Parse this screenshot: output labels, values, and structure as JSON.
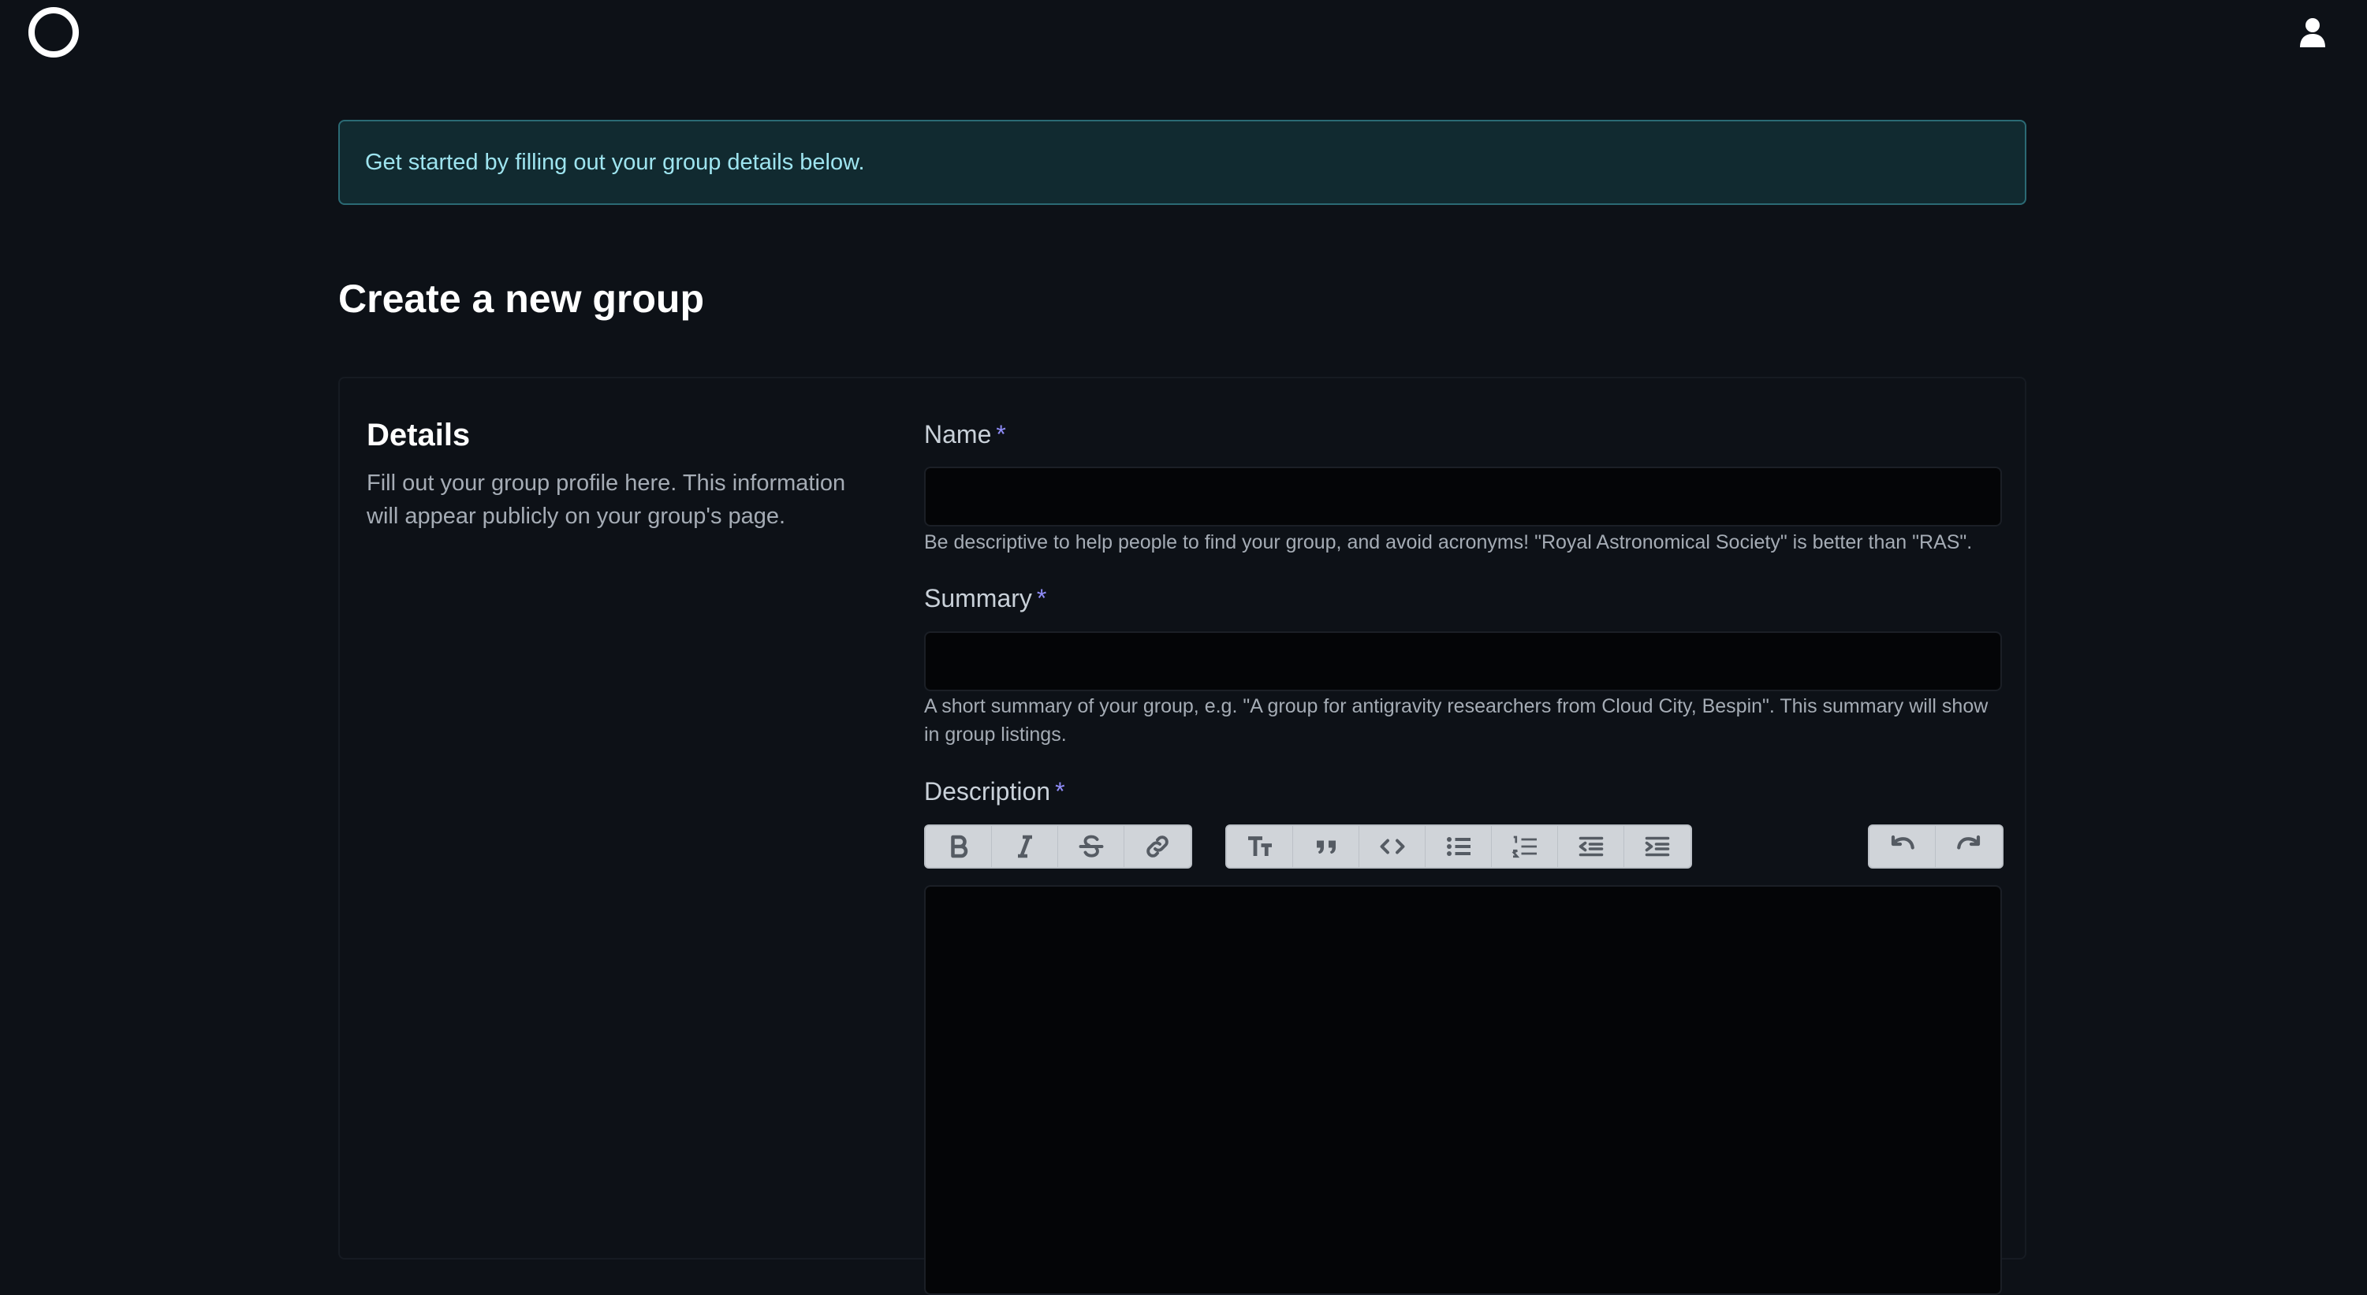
{
  "banner": {
    "text": "Get started by filling out your group details below."
  },
  "page": {
    "title": "Create a new group"
  },
  "details": {
    "title": "Details",
    "description": "Fill out your group profile here. This information will appear publicly on your group's page."
  },
  "fields": {
    "name": {
      "label": "Name",
      "required_marker": "*",
      "value": "",
      "help": "Be descriptive to help people to find your group, and avoid acronyms! \"Royal Astronomical Society\" is better than \"RAS\"."
    },
    "summary": {
      "label": "Summary",
      "required_marker": "*",
      "value": "",
      "help": "A short summary of your group, e.g. \"A group for antigravity researchers from Cloud City, Bespin\". This summary will show in group listings."
    },
    "description": {
      "label": "Description",
      "required_marker": "*",
      "value": ""
    }
  },
  "toolbar": {
    "groups": [
      [
        "bold-icon",
        "italic-icon",
        "strikethrough-icon",
        "link-icon"
      ],
      [
        "heading-icon",
        "quote-icon",
        "code-icon",
        "bullet-list-icon",
        "numbered-list-icon",
        "outdent-icon",
        "indent-icon"
      ],
      [
        "undo-icon",
        "redo-icon"
      ]
    ]
  },
  "header": {
    "icons": [
      "logo-icon",
      "user-icon"
    ]
  },
  "colors": {
    "background": "#0d1117",
    "banner_bg": "#112a30",
    "banner_text": "#9ee4ef",
    "required_marker": "#8f8cf7",
    "toolbar_bg": "#d0d4d9"
  }
}
